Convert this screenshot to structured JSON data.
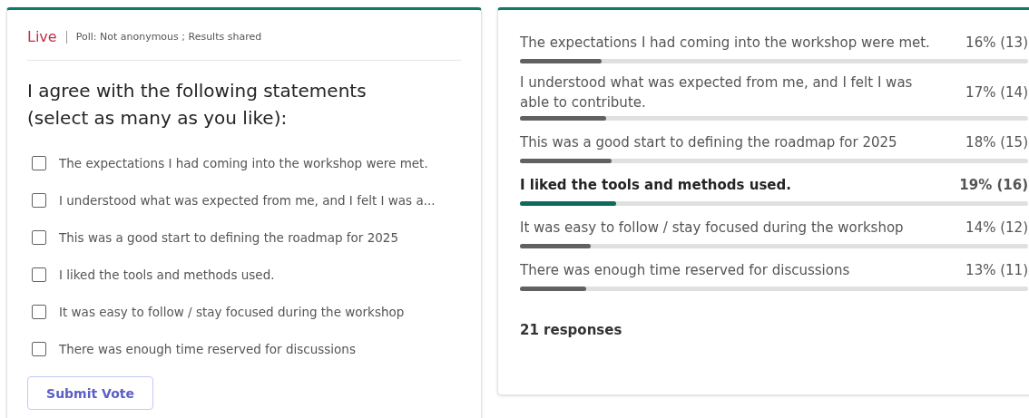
{
  "poll": {
    "status": "Live",
    "meta": "Poll: Not anonymous ; Results shared",
    "question": "I agree with the following statements (select as many as you like):",
    "options": [
      {
        "label": "The expectations I had coming into the workshop were met.",
        "checked": false
      },
      {
        "label": "I understood what was expected from me, and I felt I was a...",
        "checked": false
      },
      {
        "label": "This was a good start to defining the roadmap for 2025",
        "checked": false
      },
      {
        "label": "I liked the tools and methods used.",
        "checked": false
      },
      {
        "label": "It was easy to follow / stay focused during the workshop",
        "checked": false
      },
      {
        "label": "There was enough time reserved for discussions",
        "checked": false
      }
    ],
    "submit": "Submit Vote"
  },
  "results": {
    "rows": [
      {
        "label": "The expectations I had coming into the workshop were met.",
        "reading": "16% (13)",
        "level": 0.16,
        "leading": false
      },
      {
        "label": "I understood what was expected from me, and I felt I was able to contribute.",
        "reading": "17% (14)",
        "level": 0.17,
        "leading": false
      },
      {
        "label": "This was a good start to defining the roadmap for 2025",
        "reading": "18% (15)",
        "level": 0.18,
        "leading": false
      },
      {
        "label": "I liked the tools and methods used.",
        "reading": "19% (16)",
        "level": 0.19,
        "leading": true
      },
      {
        "label": "It was easy to follow / stay focused during the workshop",
        "reading": "14% (12)",
        "level": 0.14,
        "leading": false
      },
      {
        "label": "There was enough time reserved for discussions",
        "reading": "13% (11)",
        "level": 0.13,
        "leading": false
      }
    ],
    "total": "21 responses"
  }
}
